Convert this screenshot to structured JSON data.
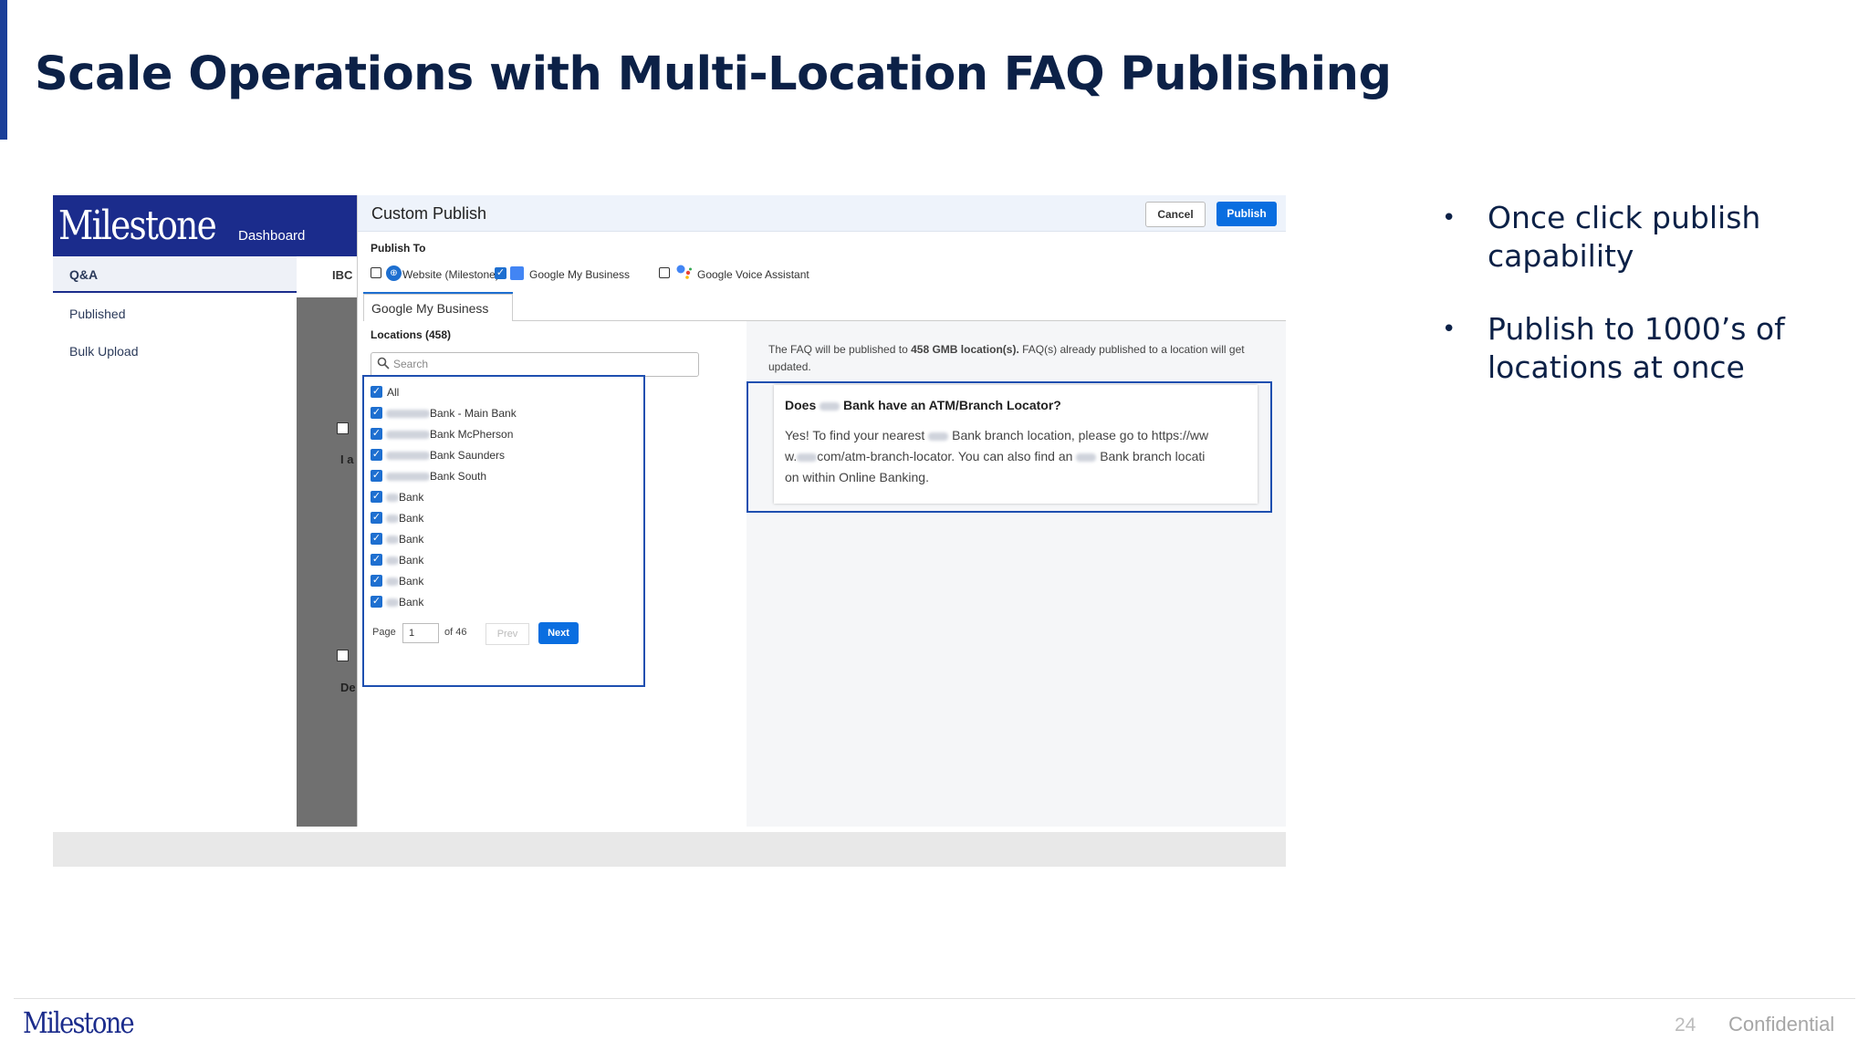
{
  "slide": {
    "title": "Scale Operations with Multi-Location FAQ Publishing",
    "bullets": [
      "Once click publish capability",
      "Publish to 1000’s of locations at once"
    ],
    "footer": {
      "logo": "Milestone",
      "page_number": "24",
      "confidential": "Confidential"
    }
  },
  "app": {
    "logo": "Milestone",
    "nav_dashboard": "Dashboard",
    "sidebar": {
      "active": "Q&A",
      "items": [
        "Published",
        "Bulk Upload"
      ]
    },
    "behind_text": "IBC",
    "behind_fragments": [
      "I a",
      "De"
    ]
  },
  "dialog": {
    "title": "Custom Publish",
    "cancel_label": "Cancel",
    "publish_label": "Publish",
    "publish_to_label": "Publish To",
    "targets": [
      {
        "label": "Website (Milestone)",
        "checked": false
      },
      {
        "label": "Google My Business",
        "checked": true
      },
      {
        "label": "Google Voice Assistant",
        "checked": false
      }
    ],
    "tab_label": "Google My Business",
    "locations_label": "Locations (458)",
    "search_placeholder": "Search",
    "all_label": "All",
    "locations": [
      "Bank - Main Bank",
      "Bank McPherson",
      "Bank Saunders",
      "Bank South",
      "Bank",
      "Bank",
      "Bank",
      "Bank",
      "Bank",
      "Bank"
    ],
    "pager": {
      "page_label": "Page",
      "page_value": "1",
      "of_label": "of 46",
      "prev_label": "Prev",
      "next_label": "Next"
    },
    "info_part1": "The FAQ will be published to ",
    "info_bold": "458 GMB location(s).",
    "info_part2": " FAQ(s) already published to a location will get updated.",
    "faq": {
      "q_prefix": "Does",
      "q_suffix": "Bank have an ATM/Branch Locator?",
      "a1": "Yes! To find your nearest",
      "a2": "Bank branch location, please go to https://ww",
      "a3": "w.",
      "a4": "com/atm-branch-locator. You can also find an",
      "a5": "Bank branch locati",
      "a6": "on within Online Banking."
    }
  },
  "colors": {
    "title": "#0c2147",
    "accent": "#1a3f99",
    "brand": "#1b2c8c",
    "primary_button": "#0a6ee0"
  }
}
